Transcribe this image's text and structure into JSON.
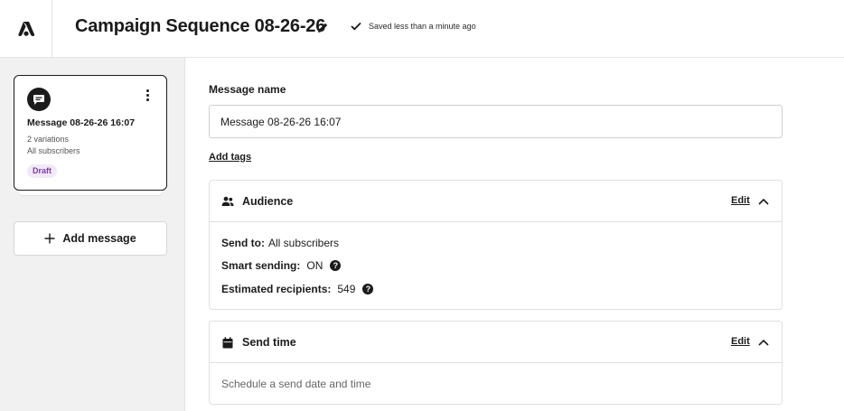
{
  "header": {
    "title": "Campaign Sequence 08-26-26",
    "saved_status": "Saved less than a minute ago"
  },
  "sidebar": {
    "message_card": {
      "title": "Message 08-26-26 16:07",
      "variations": "2 variations",
      "audience": "All subscribers",
      "status": "Draft"
    },
    "add_message_label": "Add message"
  },
  "main": {
    "message_name_label": "Message name",
    "message_name_value": "Message 08-26-26 16:07",
    "add_tags_label": "Add tags",
    "audience": {
      "title": "Audience",
      "edit_label": "Edit",
      "send_to_label": "Send to:",
      "send_to_value": "All subscribers",
      "smart_sending_label": "Smart sending:",
      "smart_sending_value": "ON",
      "estimated_label": "Estimated recipients:",
      "estimated_value": "549"
    },
    "send_time": {
      "title": "Send time",
      "edit_label": "Edit",
      "description": "Schedule a send date and time"
    }
  },
  "colors": {
    "draft_badge_bg": "#f1e9f7",
    "draft_badge_text": "#7a3fa0",
    "sidebar_bg": "#f1f1f1"
  }
}
